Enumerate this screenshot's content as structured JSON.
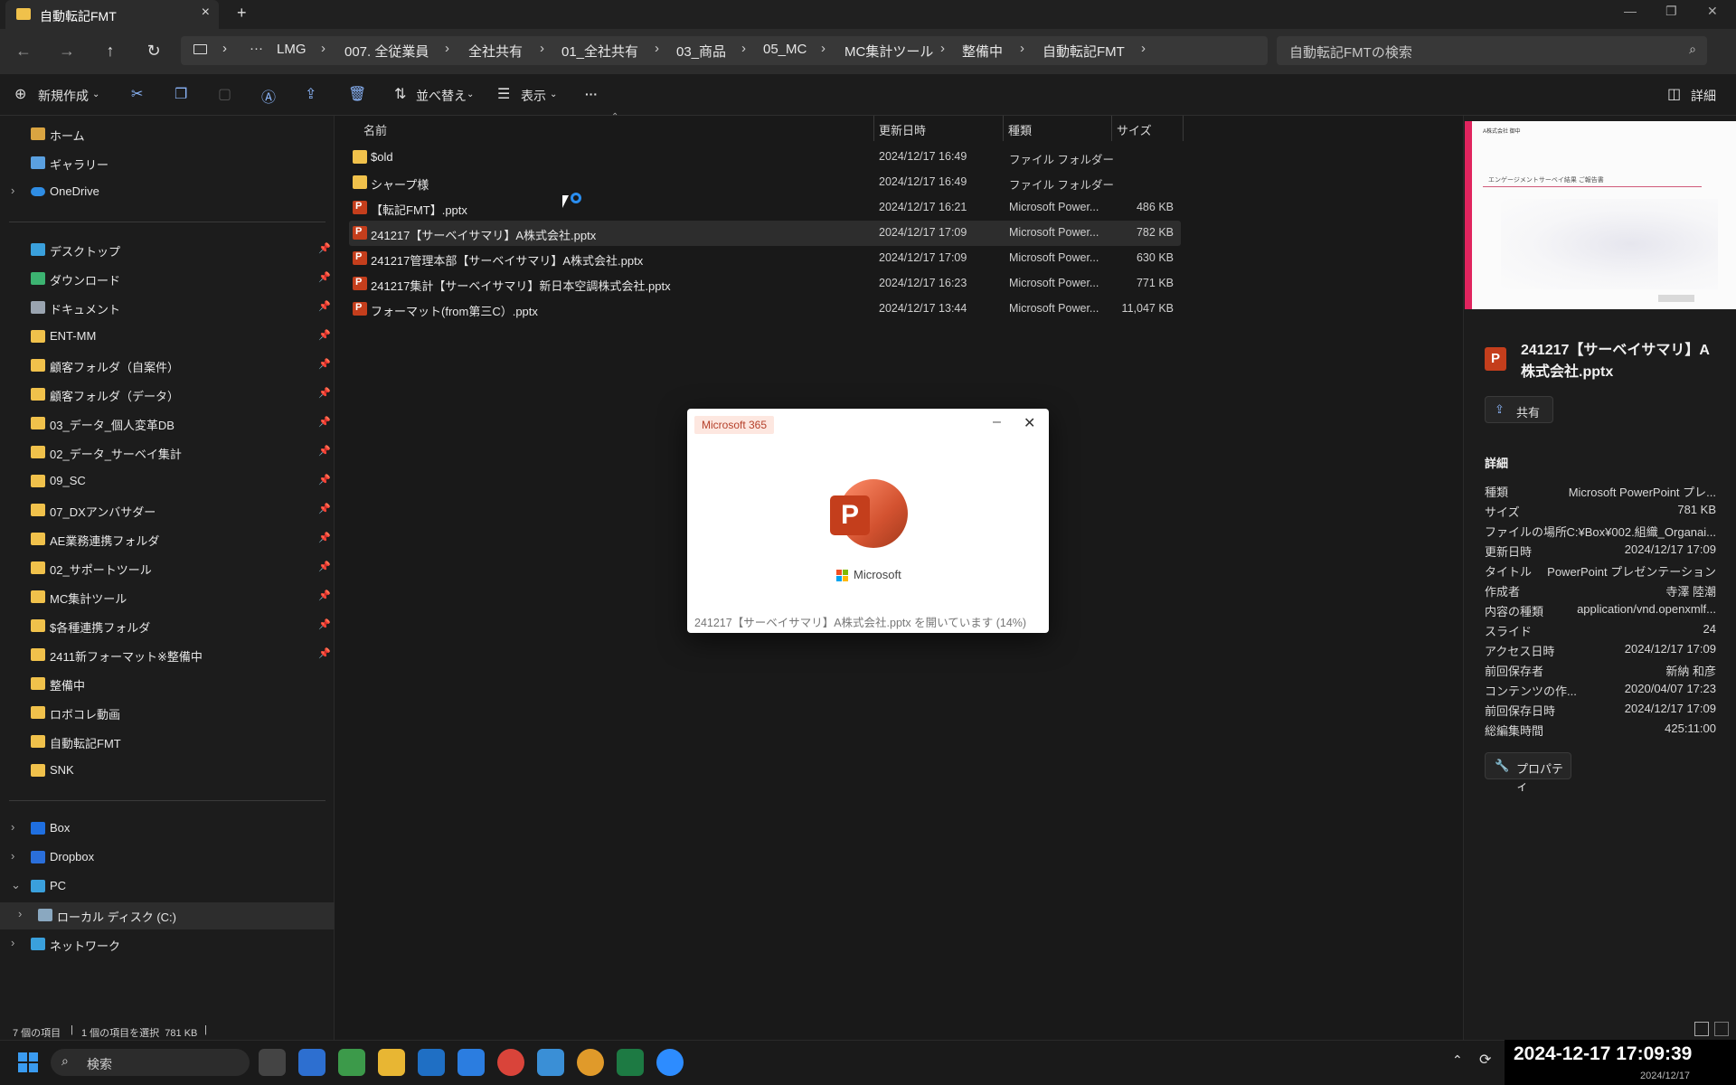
{
  "window": {
    "tab_title": "自動転記FMT"
  },
  "breadcrumb": [
    "LMG",
    "007. 全従業員",
    "全社共有",
    "01_全社共有",
    "03_商品",
    "05_MC",
    "MC集計ツール",
    "整備中",
    "自動転記FMT"
  ],
  "search": {
    "placeholder": "自動転記FMTの検索"
  },
  "toolbar": {
    "new": "新規作成",
    "sort": "並べ替え",
    "view": "表示",
    "more": "···",
    "details": "詳細"
  },
  "nav": {
    "quick": [
      {
        "label": "ホーム",
        "icon": "home-icon"
      },
      {
        "label": "ギャラリー",
        "icon": "gallery-icon"
      },
      {
        "label": "OneDrive",
        "icon": "cloud-icon"
      }
    ],
    "pinned": [
      {
        "label": "デスクトップ",
        "icon": "desktop-icon"
      },
      {
        "label": "ダウンロード",
        "icon": "download-icon"
      },
      {
        "label": "ドキュメント",
        "icon": "document-icon"
      },
      {
        "label": "ENT-MM",
        "icon": "folder-icon"
      },
      {
        "label": "顧客フォルダ（自案件）",
        "icon": "folder-icon"
      },
      {
        "label": "顧客フォルダ（データ）",
        "icon": "folder-icon"
      },
      {
        "label": "03_データ_個人変革DB",
        "icon": "folder-icon"
      },
      {
        "label": "02_データ_サーベイ集計",
        "icon": "folder-icon"
      },
      {
        "label": "09_SC",
        "icon": "folder-icon"
      },
      {
        "label": "07_DXアンバサダー",
        "icon": "folder-icon"
      },
      {
        "label": "AE業務連携フォルダ",
        "icon": "folder-icon"
      },
      {
        "label": "02_サポートツール",
        "icon": "folder-icon"
      },
      {
        "label": "MC集計ツール",
        "icon": "folder-icon"
      },
      {
        "label": "$各種連携フォルダ",
        "icon": "folder-icon"
      },
      {
        "label": "2411新フォーマット※整備中",
        "icon": "folder-icon"
      }
    ],
    "recent": [
      {
        "label": "整備中",
        "icon": "folder-icon"
      },
      {
        "label": "ロボコレ動画",
        "icon": "folder-icon"
      },
      {
        "label": "自動転記FMT",
        "icon": "folder-icon"
      },
      {
        "label": "SNK",
        "icon": "folder-icon"
      }
    ],
    "drives": [
      {
        "label": "Box",
        "icon": "box-icon"
      },
      {
        "label": "Dropbox",
        "icon": "dropbox-icon"
      },
      {
        "label": "PC",
        "icon": "pc-icon"
      },
      {
        "label": "ローカル ディスク (C:)",
        "icon": "disk-icon"
      },
      {
        "label": "ネットワーク",
        "icon": "network-icon"
      }
    ]
  },
  "columns": {
    "name": "名前",
    "date": "更新日時",
    "type": "種類",
    "size": "サイズ"
  },
  "files": [
    {
      "name": "$old",
      "date": "2024/12/17 16:49",
      "type": "ファイル フォルダー",
      "size": "",
      "kind": "folder"
    },
    {
      "name": "シャープ様",
      "date": "2024/12/17 16:49",
      "type": "ファイル フォルダー",
      "size": "",
      "kind": "folder"
    },
    {
      "name": "【転記FMT】.pptx",
      "date": "2024/12/17 16:21",
      "type": "Microsoft Power...",
      "size": "486 KB",
      "kind": "pptx"
    },
    {
      "name": "241217【サーベイサマリ】A株式会社.pptx",
      "date": "2024/12/17 17:09",
      "type": "Microsoft Power...",
      "size": "782 KB",
      "kind": "pptx"
    },
    {
      "name": "241217管理本部【サーベイサマリ】A株式会社.pptx",
      "date": "2024/12/17 17:09",
      "type": "Microsoft Power...",
      "size": "630 KB",
      "kind": "pptx"
    },
    {
      "name": "241217集計【サーベイサマリ】新日本空調株式会社.pptx",
      "date": "2024/12/17 16:23",
      "type": "Microsoft Power...",
      "size": "771 KB",
      "kind": "pptx"
    },
    {
      "name": "フォーマット(from第三C）.pptx",
      "date": "2024/12/17 13:44",
      "type": "Microsoft Power...",
      "size": "11,047 KB",
      "kind": "pptx"
    }
  ],
  "details": {
    "thumb_title": "エンゲージメントサーベイ結果 ご報告書",
    "thumb_header": "A株式会社 御中",
    "file_name": "241217【サーベイサマリ】A株式会社.pptx",
    "share": "共有",
    "heading": "詳細",
    "props": [
      {
        "k": "種類",
        "v": "Microsoft PowerPoint プレ..."
      },
      {
        "k": "サイズ",
        "v": "781 KB"
      },
      {
        "k": "ファイルの場所",
        "v": "C:¥Box¥002.組織_Organai..."
      },
      {
        "k": "更新日時",
        "v": "2024/12/17 17:09"
      },
      {
        "k": "タイトル",
        "v": "PowerPoint プレゼンテーション"
      },
      {
        "k": "作成者",
        "v": "寺澤 陸潮"
      },
      {
        "k": "内容の種類",
        "v": "application/vnd.openxmlf..."
      },
      {
        "k": "スライド",
        "v": "24"
      },
      {
        "k": "アクセス日時",
        "v": "2024/12/17 17:09"
      },
      {
        "k": "前回保存者",
        "v": "新納 和彦"
      },
      {
        "k": "コンテンツの作...",
        "v": "2020/04/07 17:23"
      },
      {
        "k": "前回保存日時",
        "v": "2024/12/17 17:09"
      },
      {
        "k": "総編集時間",
        "v": "425:11:00"
      }
    ],
    "properties_btn": "プロパティ"
  },
  "splash": {
    "badge": "Microsoft 365",
    "brand": "Microsoft",
    "status": "241217【サーベイサマリ】A株式会社.pptx を開いています (14%)",
    "progress": 14
  },
  "status": {
    "count": "7 個の項目",
    "selected": "1 個の項目を選択  781 KB"
  },
  "taskbar": {
    "search": "検索",
    "clock": "2024-12-17 17:09:39",
    "date_small": "2024/12/17"
  },
  "colors": {
    "accent": "#0078d4",
    "folder": "#f0c14b",
    "ppt": "#c43e1c",
    "selection": "#2d2d2d"
  }
}
